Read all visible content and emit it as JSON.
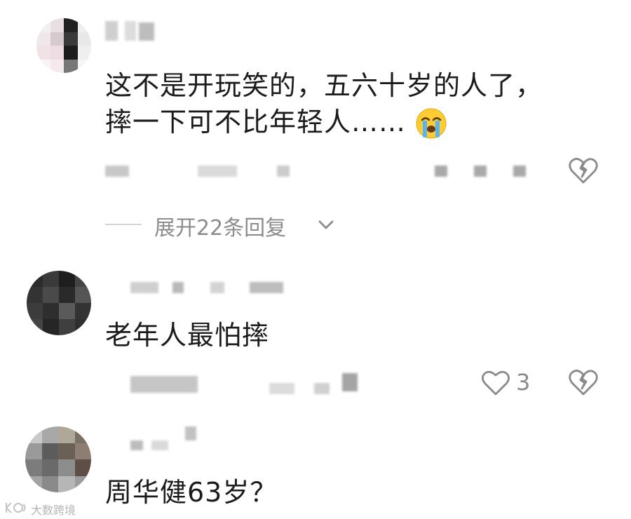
{
  "comments": [
    {
      "text_line1": "这不是开玩笑的，五六十岁的人了，",
      "text_line2": "摔一下可不比年轻人……",
      "emoji_icon": "loudly-crying-face-icon",
      "dislike_icon": "broken-heart-icon",
      "expand_replies_label": "展开22条回复"
    },
    {
      "text": "老年人最怕摔",
      "like_icon": "heart-outline-icon",
      "like_count": "3",
      "dislike_icon": "broken-heart-icon"
    },
    {
      "text": "周华健63岁？"
    }
  ],
  "watermark": "大数跨境",
  "colors": {
    "text": "#1b1b1b",
    "secondary": "#8c8c8c",
    "icon": "#8a8a8a"
  }
}
